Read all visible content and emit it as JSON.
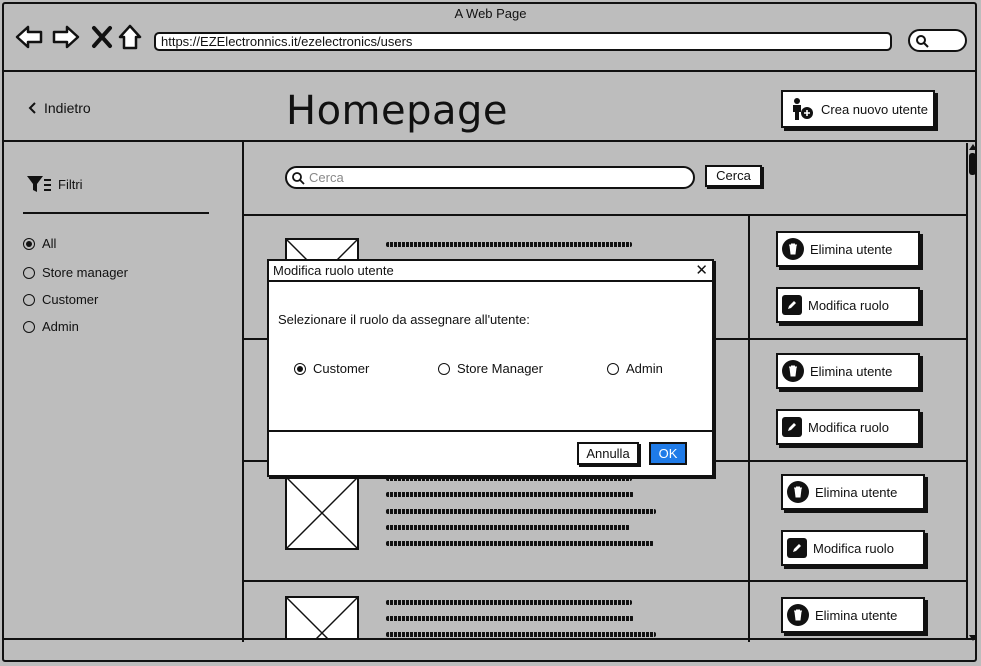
{
  "window": {
    "title": "A Web Page",
    "url": "https://EZElectronnics.it/ezelectronics/users"
  },
  "header": {
    "back_label": "Indietro",
    "page_title": "Homepage",
    "create_user_label": "Crea nuovo utente"
  },
  "sidebar": {
    "filters_label": "Filtri",
    "options": [
      {
        "label": "All",
        "selected": true
      },
      {
        "label": "Store manager",
        "selected": false
      },
      {
        "label": "Customer",
        "selected": false
      },
      {
        "label": "Admin",
        "selected": false
      }
    ]
  },
  "search": {
    "placeholder": "Cerca",
    "button_label": "Cerca"
  },
  "rows": {
    "delete_label": "Elimina utente",
    "edit_role_label": "Modifica ruolo"
  },
  "dialog": {
    "title": "Modifica ruolo utente",
    "prompt": "Selezionare il ruolo da assegnare all'utente:",
    "roles": [
      {
        "label": "Customer",
        "selected": true
      },
      {
        "label": "Store Manager",
        "selected": false
      },
      {
        "label": "Admin",
        "selected": false
      }
    ],
    "cancel_label": "Annulla",
    "ok_label": "OK"
  },
  "colors": {
    "background": "#bdbdbd",
    "primary": "#1f7be8"
  }
}
